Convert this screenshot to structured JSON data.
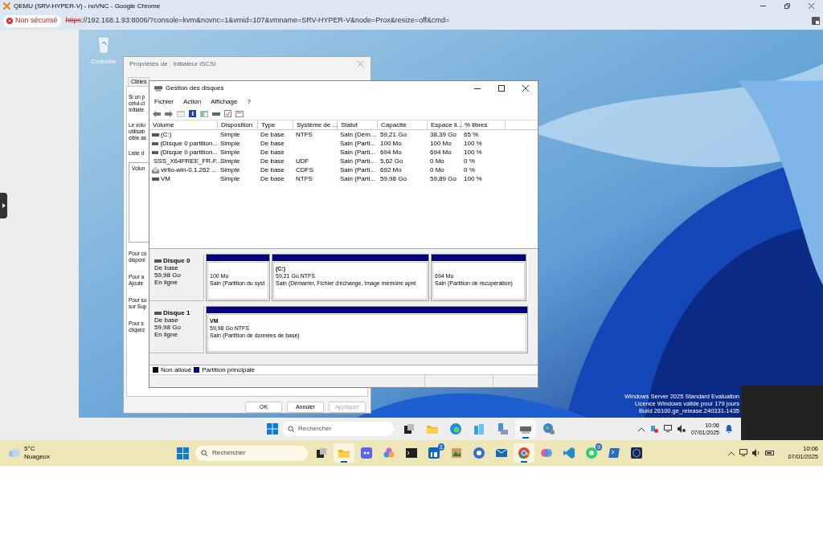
{
  "browser": {
    "title": "QEMU (SRV-HYPER-V) - noVNC - Google Chrome",
    "security_label": "Non sécurisé",
    "url_scheme": "https",
    "url_rest": "://192.168.1.93:8006/?console=kvm&novnc=1&vmid=107&vmname=SRV-HYPER-V&node=Prox&resize=off&cmd="
  },
  "vm": {
    "desktop_icons": [
      {
        "label": "Corbeille"
      }
    ],
    "iscsi_dialog": {
      "title": "Propriétés de : Initiateur iSCSI",
      "tabs": [
        {
          "label": "Cibles",
          "selected": false
        }
      ],
      "paragraphs": [
        [
          "Si un p",
          "celui-ci",
          "Initiate"
        ],
        [
          "Le volu",
          "utilisab",
          "cible as"
        ],
        [
          "Liste d"
        ]
      ],
      "list_header": "Volun",
      "lower_paragraphs": [
        [
          "Pour co",
          "disponi"
        ],
        [
          "Pour a",
          "Ajoute"
        ],
        [
          "Pour su",
          "sur Sup"
        ],
        [
          "Pour s",
          "cliquez"
        ]
      ],
      "buttons": [
        {
          "label": "OK",
          "disabled": false
        },
        {
          "label": "Annuler",
          "disabled": false
        },
        {
          "label": "Appliquer",
          "disabled": true
        }
      ]
    },
    "disk_mgmt": {
      "title": "Gestion des disques",
      "menu": [
        "Fichier",
        "Action",
        "Affichage",
        "?"
      ],
      "columns": [
        "Volume",
        "Disposition",
        "Type",
        "Système de ...",
        "Statut",
        "Capacité",
        "Espace li...",
        "% libres"
      ],
      "rows": [
        {
          "kind": "disk",
          "cells": [
            "(C:)",
            "Simple",
            "De base",
            "NTFS",
            "Sain (Dém...",
            "59,21 Go",
            "38,39 Go",
            "65 %"
          ]
        },
        {
          "kind": "disk",
          "cells": [
            "(Disque 0 partition...",
            "Simple",
            "De base",
            "",
            "Sain (Parti...",
            "100 Mo",
            "100 Mo",
            "100 %"
          ]
        },
        {
          "kind": "disk",
          "cells": [
            "(Disque 0 partition...",
            "Simple",
            "De base",
            "",
            "Sain (Parti...",
            "694 Mo",
            "694 Mo",
            "100 %"
          ]
        },
        {
          "kind": "cd",
          "cells": [
            "SSS_X64FREE_FR-F...",
            "Simple",
            "De base",
            "UDF",
            "Sain (Parti...",
            "5,62 Go",
            "0 Mo",
            "0 %"
          ]
        },
        {
          "kind": "cd",
          "cells": [
            "virtio-win-0.1.262 ...",
            "Simple",
            "De base",
            "CDFS",
            "Sain (Parti...",
            "692 Mo",
            "0 Mo",
            "0 %"
          ]
        },
        {
          "kind": "disk",
          "cells": [
            "VM",
            "Simple",
            "De base",
            "NTFS",
            "Sain (Parti...",
            "59,98 Go",
            "59,89 Go",
            "100 %"
          ]
        }
      ],
      "disks": [
        {
          "name": "Disque 0",
          "lines": [
            "De base",
            "59,98 Go",
            "En ligne"
          ],
          "partitions": [
            {
              "size": "100 Mo",
              "status": "Sain (Partition du syst"
            },
            {
              "title": "(C:)",
              "size": "59,21 Go NTFS",
              "status": "Sain (Démarrer, Fichier d'échange, Image mémoire apré"
            },
            {
              "size": "694 Mo",
              "status": "Sain (Partition de récupération)"
            }
          ]
        },
        {
          "name": "Disque 1",
          "lines": [
            "De base",
            "59,98 Go",
            "En ligne"
          ],
          "partitions": [
            {
              "title": "VM",
              "size": "59,98 Go NTFS",
              "status": "Sain (Partition de données de base)"
            }
          ]
        }
      ],
      "legend": [
        {
          "label": "Non alloué",
          "color": "#000000"
        },
        {
          "label": "Partition principale",
          "color": "#000080"
        }
      ]
    },
    "watermark": [
      "Windows Server 2025 Standard Evaluation",
      "Licence Windows valide pour 179 jours",
      "Build 26100.ge_release.240331-1435"
    ],
    "taskbar": {
      "search_placeholder": "Rechercher",
      "apps": [
        {
          "kind": "taskview",
          "active": false
        },
        {
          "kind": "folder",
          "active": false
        },
        {
          "kind": "edge",
          "active": false
        },
        {
          "kind": "buildings",
          "active": false
        },
        {
          "kind": "server",
          "active": false
        },
        {
          "kind": "diskmgmt",
          "active": true
        },
        {
          "kind": "globe",
          "active": false
        }
      ],
      "time": "10:06",
      "date": "07/01/2025"
    }
  },
  "host_taskbar": {
    "temperature": "5°C",
    "condition": "Nuageux",
    "search_placeholder": "Rechercher",
    "apps": [
      {
        "kind": "taskview",
        "active": false
      },
      {
        "kind": "folder",
        "active": true
      },
      {
        "kind": "controller",
        "active": false
      },
      {
        "kind": "flower",
        "active": false
      },
      {
        "kind": "terminal",
        "active": false
      },
      {
        "kind": "in",
        "active": false,
        "badge": "1"
      },
      {
        "kind": "painting",
        "active": false
      },
      {
        "kind": "ebrowser",
        "active": false
      },
      {
        "kind": "mail",
        "active": false
      },
      {
        "kind": "chrome",
        "active": true
      },
      {
        "kind": "swirl",
        "active": false
      },
      {
        "kind": "code",
        "active": false
      },
      {
        "kind": "phone",
        "active": false,
        "badge": "9"
      },
      {
        "kind": "shell",
        "active": false
      },
      {
        "kind": "hex",
        "active": false
      }
    ],
    "time": "10:06",
    "date": "07/01/2025"
  }
}
